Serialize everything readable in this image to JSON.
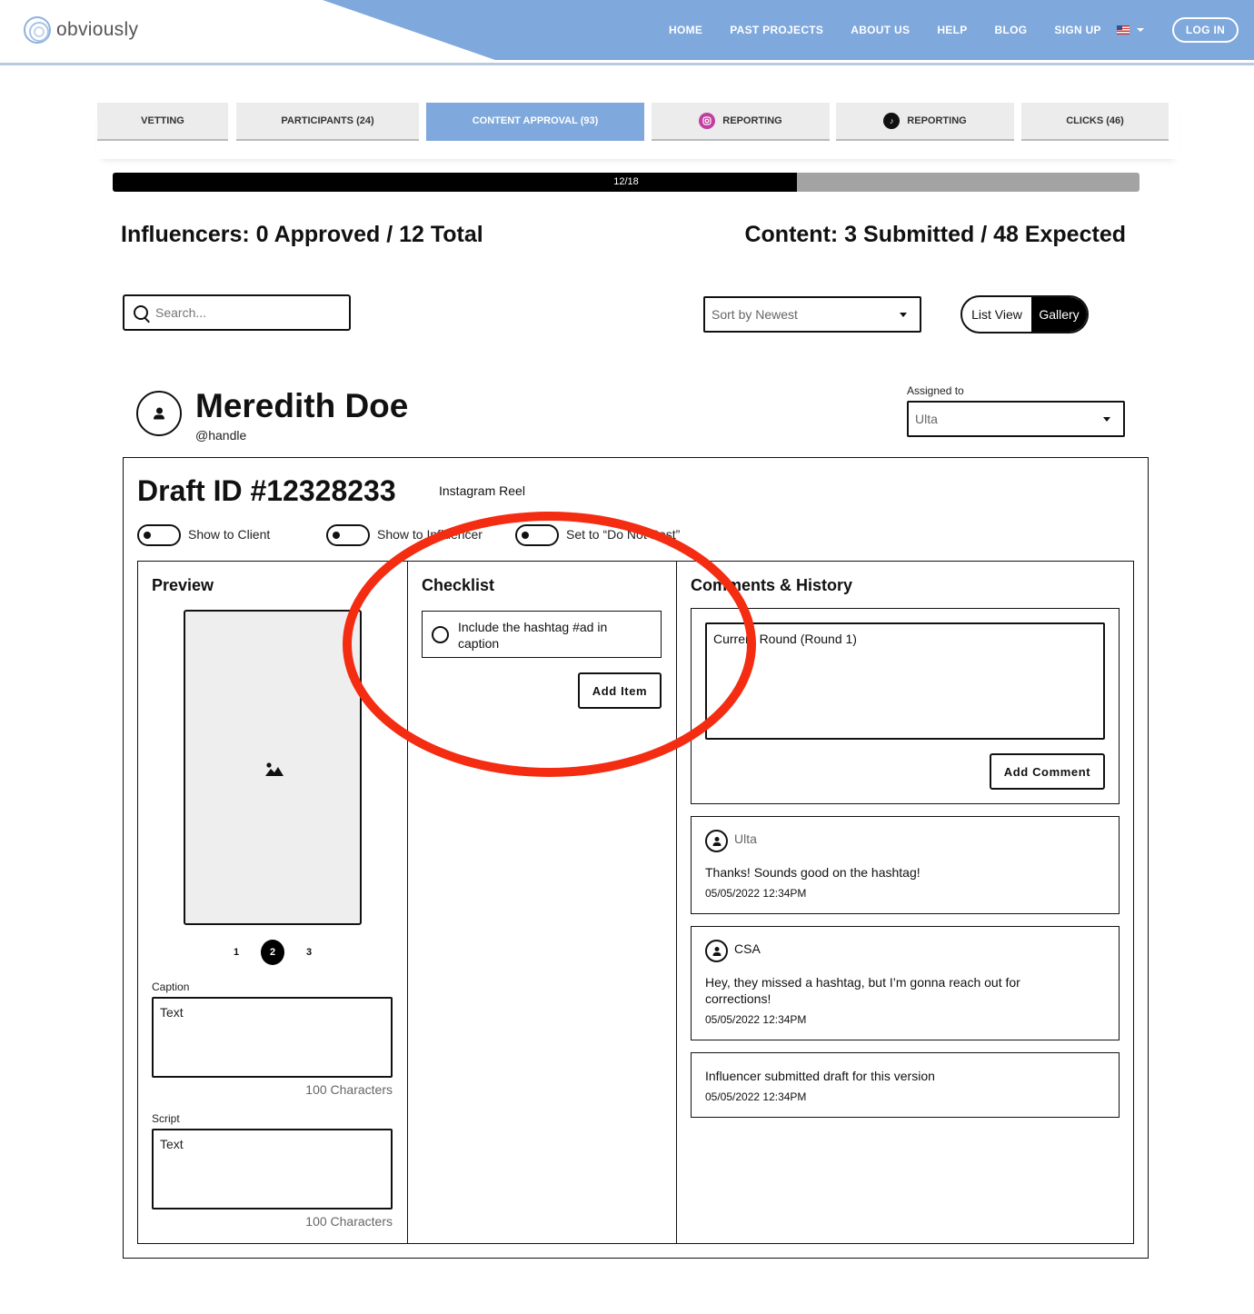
{
  "brand": {
    "name": "obviously"
  },
  "nav": {
    "items": [
      "HOME",
      "PAST PROJECTS",
      "ABOUT US",
      "HELP",
      "BLOG",
      "SIGN UP"
    ],
    "login": "LOG IN",
    "flag": "us-flag-icon"
  },
  "tabs": [
    {
      "label": "VETTING"
    },
    {
      "label": "PARTICIPANTS (24)"
    },
    {
      "label": "CONTENT APPROVAL (93)",
      "active": true
    },
    {
      "label": "REPORTING",
      "icon": "instagram-icon"
    },
    {
      "label": "REPORTING",
      "icon": "tiktok-icon"
    },
    {
      "label": "CLICKS (46)"
    }
  ],
  "progress": {
    "label": "12/18",
    "current": 12,
    "total": 18
  },
  "stats": {
    "influencers": "Influencers: 0 Approved / 12 Total",
    "content": "Content: 3 Submitted / 48 Expected"
  },
  "search": {
    "placeholder": "Search...",
    "value": ""
  },
  "sort": {
    "selected": "Sort by Newest"
  },
  "view": {
    "list": "List View",
    "gallery": "Gallery",
    "active": "gallery"
  },
  "influencer": {
    "name": "Meredith Doe",
    "handle": "@handle"
  },
  "assigned": {
    "label": "Assigned to",
    "selected": "Ulta"
  },
  "draft": {
    "id": "Draft ID #12328233",
    "type": "Instagram Reel",
    "toggles": [
      {
        "label": "Show to Client",
        "on": false
      },
      {
        "label": "Show to Influencer",
        "on": false
      },
      {
        "label": "Set to “Do Not Post”",
        "on": false
      }
    ]
  },
  "preview": {
    "title": "Preview",
    "pages": [
      "1",
      "2",
      "3"
    ],
    "active_page": "2",
    "caption": {
      "label": "Caption",
      "value": "Text",
      "count": "100 Characters"
    },
    "script": {
      "label": "Script",
      "value": "Text",
      "count": "100 Characters"
    }
  },
  "checklist": {
    "title": "Checklist",
    "items": [
      {
        "text": "Include the hashtag #ad in caption",
        "checked": false
      }
    ],
    "add_label": "Add Item"
  },
  "comments": {
    "title": "Comments & History",
    "round_placeholder": "Current Round (Round 1)",
    "add_label": "Add Comment",
    "entries": [
      {
        "author": "Ulta",
        "text": "Thanks! Sounds good on the hashtag!",
        "time": "05/05/2022 12:34PM"
      },
      {
        "author": "CSA",
        "text": "Hey, they missed a hashtag, but I’m gonna reach out for corrections!",
        "time": "05/05/2022 12:34PM"
      },
      {
        "author": "",
        "text": "Influencer submitted draft for this version",
        "time": "05/05/2022 12:34PM"
      }
    ]
  },
  "colors": {
    "header_blue": "#7fa8dd",
    "annotation_red": "#f42c12",
    "instagram": "#c13fa0"
  }
}
